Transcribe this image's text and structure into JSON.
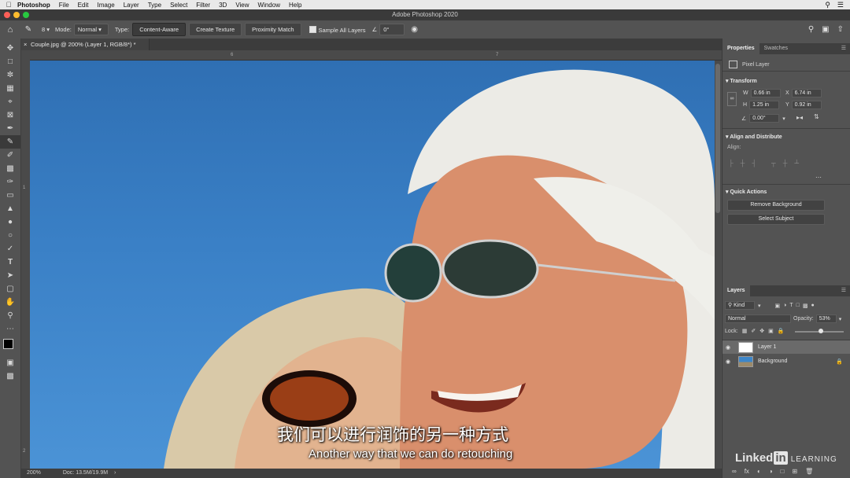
{
  "mac_menu": {
    "app": "Photoshop",
    "items": [
      "File",
      "Edit",
      "Image",
      "Layer",
      "Type",
      "Select",
      "Filter",
      "3D",
      "View",
      "Window",
      "Help"
    ]
  },
  "window_title": "Adobe Photoshop 2020",
  "options_bar": {
    "brush_size": "8",
    "mode_label": "Mode:",
    "mode_value": "Normal",
    "type_label": "Type:",
    "type_buttons": [
      "Content-Aware",
      "Create Texture",
      "Proximity Match"
    ],
    "sample_all_layers": "Sample All Layers",
    "angle_value": "0°"
  },
  "document": {
    "tab_title": "Couple.jpg @ 200% (Layer 1, RGB/8*) *",
    "ruler_marks": [
      "6",
      "7"
    ],
    "vruler_marks": [
      "1",
      "2"
    ],
    "zoom": "200%",
    "doc_size": "Doc: 13.5M/19.9M"
  },
  "properties": {
    "tabs": [
      "Properties",
      "Swatches"
    ],
    "layer_kind": "Pixel Layer",
    "transform_title": "Transform",
    "w_label": "W",
    "w_value": "0.66 in",
    "x_label": "X",
    "x_value": "6.74 in",
    "h_label": "H",
    "h_value": "1.25 in",
    "y_label": "Y",
    "y_value": "0.92 in",
    "angle_value": "0.00°",
    "align_title": "Align and Distribute",
    "align_label": "Align:",
    "quick_actions_title": "Quick Actions",
    "remove_bg": "Remove Background",
    "select_subject": "Select Subject"
  },
  "layers": {
    "tab": "Layers",
    "kind_filter": "Kind",
    "blend_mode": "Normal",
    "opacity_label": "Opacity:",
    "opacity_value": "53%",
    "opacity_fraction": 0.53,
    "lock_label": "Lock:",
    "items": [
      {
        "name": "Layer 1"
      },
      {
        "name": "Background"
      }
    ]
  },
  "subtitles": {
    "zh": "我们可以进行润饰的另一种方式",
    "en": "Another way that we can do retouching"
  },
  "brand": {
    "linked": "Linked",
    "in": "in",
    "learning": "LEARNING"
  },
  "colors": {
    "accent": "#2f6fb3",
    "panel": "#535353"
  }
}
